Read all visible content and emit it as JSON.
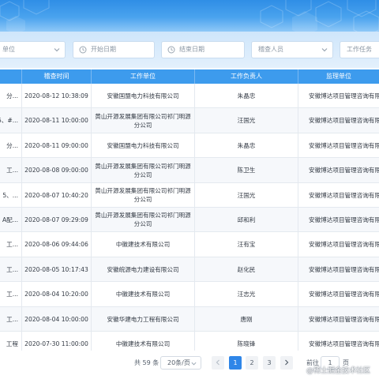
{
  "filters": {
    "unit": "单位",
    "start_date": "开始日期",
    "end_date": "结束日期",
    "inspector": "稽查人员",
    "task": "工作任务"
  },
  "table": {
    "columns": [
      "",
      "稽查时间",
      "工作单位",
      "工作负责人",
      "监理单位"
    ],
    "rows": [
      [
        "分...",
        "2020-08-12 10:38:09",
        "安徽国盟电力科技有限公司",
        "朱晶忠",
        "安徽博达项目管理咨询有限"
      ],
      [
        "5、#...",
        "2020-08-11 10:00:00",
        "黄山开源发展集团有限公司祁门明源分公司",
        "汪国光",
        "安徽博达项目管理咨询有限"
      ],
      [
        "分...",
        "2020-08-11 09:00:00",
        "安徽国盟电力科技有限公司",
        "朱晶忠",
        "安徽博达项目管理咨询有限"
      ],
      [
        "工...",
        "2020-08-08 09:00:00",
        "黄山开源发展集团有限公司祁门明源分公司",
        "陈卫生",
        "安徽博达项目管理咨询有限"
      ],
      [
        "5、...",
        "2020-08-07 10:40:20",
        "黄山开源发展集团有限公司祁门明源分公司",
        "汪国光",
        "安徽博达项目管理咨询有限"
      ],
      [
        "A配...",
        "2020-08-07 09:29:09",
        "黄山开源发展集团有限公司祁门明源分公司",
        "邱和利",
        "安徽博达项目管理咨询有限"
      ],
      [
        "工...",
        "2020-08-06 09:44:06",
        "中徽建技术有限公司",
        "汪有宝",
        "安徽博达项目管理咨询有限"
      ],
      [
        "工...",
        "2020-08-05 10:17:43",
        "安徽皖源电力建设有限公司",
        "赵化民",
        "安徽博达项目管理咨询有限"
      ],
      [
        "工...",
        "2020-08-04 10:20:00",
        "中徽建技术有限公司",
        "汪志光",
        "安徽博达项目管理咨询有限"
      ],
      [
        "工...",
        "2020-08-04 10:00:00",
        "安徽华建电力工程有限公司",
        "唐刚",
        "安徽博达项目管理咨询有限"
      ],
      [
        "工程",
        "2020-07-30 11:00:00",
        "中徽建技术有限公司",
        "陈晓锋",
        "安徽博达项目管理咨询有限"
      ]
    ]
  },
  "pagination": {
    "total": "共 59 条",
    "page_size": "20条/页",
    "pages": [
      "1",
      "2",
      "3"
    ],
    "active_page": "1",
    "goto_label": "前往",
    "goto_value": "1",
    "page_unit": "页"
  },
  "watermark": "@稀土掘金技术社区",
  "colors": {
    "header_bg": "#3d9bed",
    "active_page": "#2f86e8"
  }
}
